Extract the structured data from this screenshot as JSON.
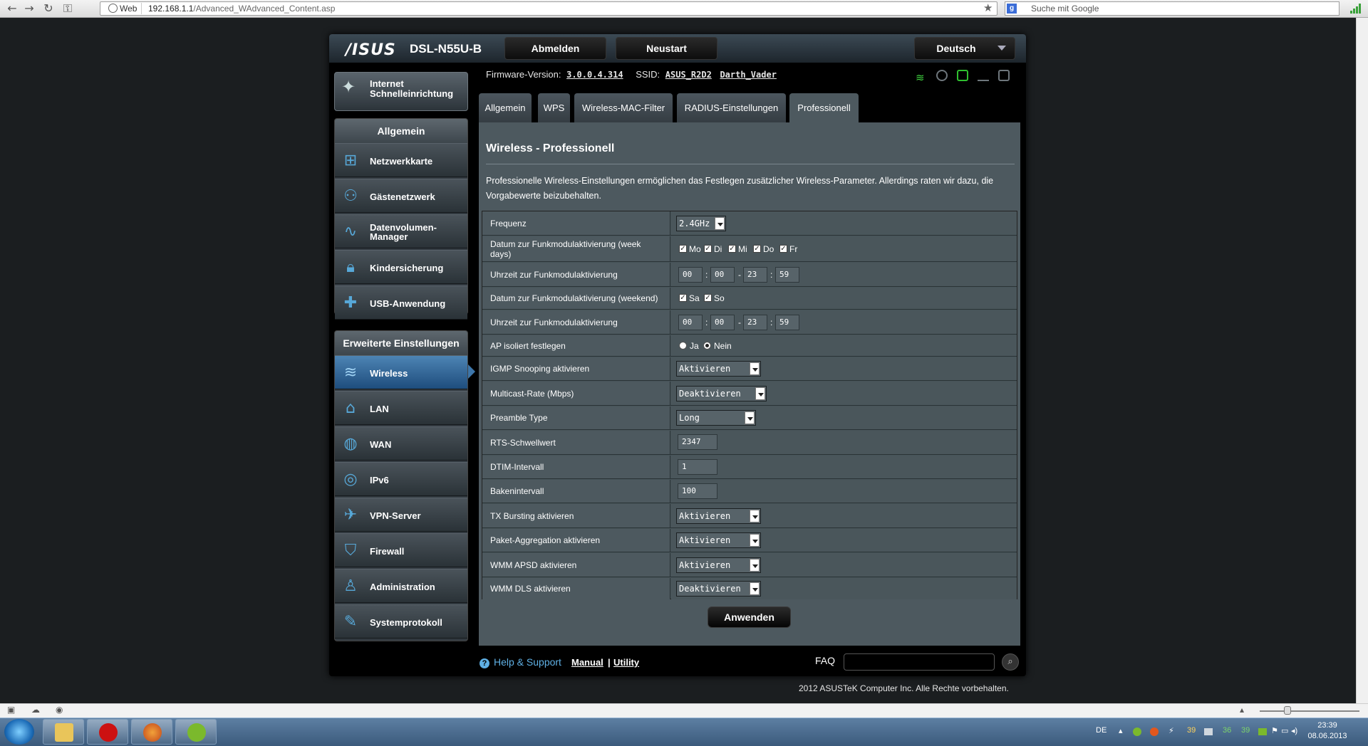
{
  "browser": {
    "site_label": "Web",
    "url_host": "192.168.1.1",
    "url_path": "/Advanced_WAdvanced_Content.asp",
    "search_placeholder": "Suche mit Google"
  },
  "header": {
    "logo": "/ISUS",
    "model": "DSL-N55U-B",
    "logout": "Abmelden",
    "reboot": "Neustart",
    "language": "Deutsch",
    "firmware_label": "Firmware-Version:",
    "firmware_value": "3.0.0.4.314",
    "ssid_label": "SSID:",
    "ssid_1": "ASUS_R2D2",
    "ssid_2": "Darth_Vader"
  },
  "sidebar": {
    "qis_label": "Internet Schnelleinrichtung",
    "general_head": "Allgemein",
    "general_items": [
      {
        "label": "Netzwerkkarte",
        "icon": "network-map-icon"
      },
      {
        "label": "Gästenetzwerk",
        "icon": "guest-network-icon"
      },
      {
        "label": "Datenvolumen-Manager",
        "icon": "traffic-manager-icon"
      },
      {
        "label": "Kindersicherung",
        "icon": "lock-icon"
      },
      {
        "label": "USB-Anwendung",
        "icon": "puzzle-icon"
      }
    ],
    "advanced_head": "Erweiterte Einstellungen",
    "advanced_items": [
      {
        "label": "Wireless",
        "icon": "wifi-icon"
      },
      {
        "label": "LAN",
        "icon": "home-icon"
      },
      {
        "label": "WAN",
        "icon": "globe-icon"
      },
      {
        "label": "IPv6",
        "icon": "ipv6-icon"
      },
      {
        "label": "VPN-Server",
        "icon": "vpn-icon"
      },
      {
        "label": "Firewall",
        "icon": "shield-icon"
      },
      {
        "label": "Administration",
        "icon": "user-icon"
      },
      {
        "label": "Systemprotokoll",
        "icon": "edit-icon"
      }
    ]
  },
  "tabs": [
    "Allgemein",
    "WPS",
    "Wireless-MAC-Filter",
    "RADIUS-Einstellungen",
    "Professionell"
  ],
  "main": {
    "title": "Wireless - Professionell",
    "description": "Professionelle Wireless-Einstellungen ermöglichen das Festlegen zusätzlicher Wireless-Parameter. Allerdings raten wir dazu, die Vorgabewerte beizubehalten.",
    "rows": {
      "frequency": {
        "label": "Frequenz",
        "value": "2.4GHz"
      },
      "weekdays": {
        "label": "Datum zur Funkmodulaktivierung (week days)",
        "days": [
          "Mo",
          "Di",
          "Mi",
          "Do",
          "Fr"
        ]
      },
      "weekday_time": {
        "label": "Uhrzeit zur Funkmodulaktivierung",
        "h1": "00",
        "m1": "00",
        "h2": "23",
        "m2": "59"
      },
      "weekend": {
        "label": "Datum zur Funkmodulaktivierung (weekend)",
        "days": [
          "Sa",
          "So"
        ]
      },
      "weekend_time": {
        "label": "Uhrzeit zur Funkmodulaktivierung",
        "h1": "00",
        "m1": "00",
        "h2": "23",
        "m2": "59"
      },
      "ap_isolated": {
        "label": "AP isoliert festlegen",
        "yes": "Ja",
        "no": "Nein"
      },
      "igmp": {
        "label": "IGMP Snooping aktivieren",
        "value": "Aktivieren"
      },
      "multicast": {
        "label": "Multicast-Rate (Mbps)",
        "value": "Deaktivieren"
      },
      "preamble": {
        "label": "Preamble Type",
        "value": "Long"
      },
      "rts": {
        "label": "RTS-Schwellwert",
        "value": "2347"
      },
      "dtim": {
        "label": "DTIM-Intervall",
        "value": "1"
      },
      "beacon": {
        "label": "Bakenintervall",
        "value": "100"
      },
      "tx_bursting": {
        "label": "TX Bursting aktivieren",
        "value": "Aktivieren"
      },
      "aggregation": {
        "label": "Paket-Aggregation aktivieren",
        "value": "Aktivieren"
      },
      "wmm_apsd": {
        "label": "WMM APSD aktivieren",
        "value": "Aktivieren"
      },
      "wmm_dls": {
        "label": "WMM DLS aktivieren",
        "value": "Deaktivieren"
      }
    },
    "apply": "Anwenden"
  },
  "footer": {
    "help": "Help & Support",
    "manual": "Manual",
    "divider": "|",
    "utility": "Utility",
    "faq": "FAQ",
    "copyright": "2012 ASUSTeK Computer Inc. Alle Rechte vorbehalten."
  },
  "taskbar": {
    "lang": "DE",
    "time": "23:39",
    "date": "08.06.2013",
    "tray_nums": [
      "39",
      "36",
      "39"
    ]
  },
  "colors": {
    "accent_blue": "#5fb0e4",
    "active_menu": "#2f6aa0",
    "content_bg": "#4d595f"
  }
}
